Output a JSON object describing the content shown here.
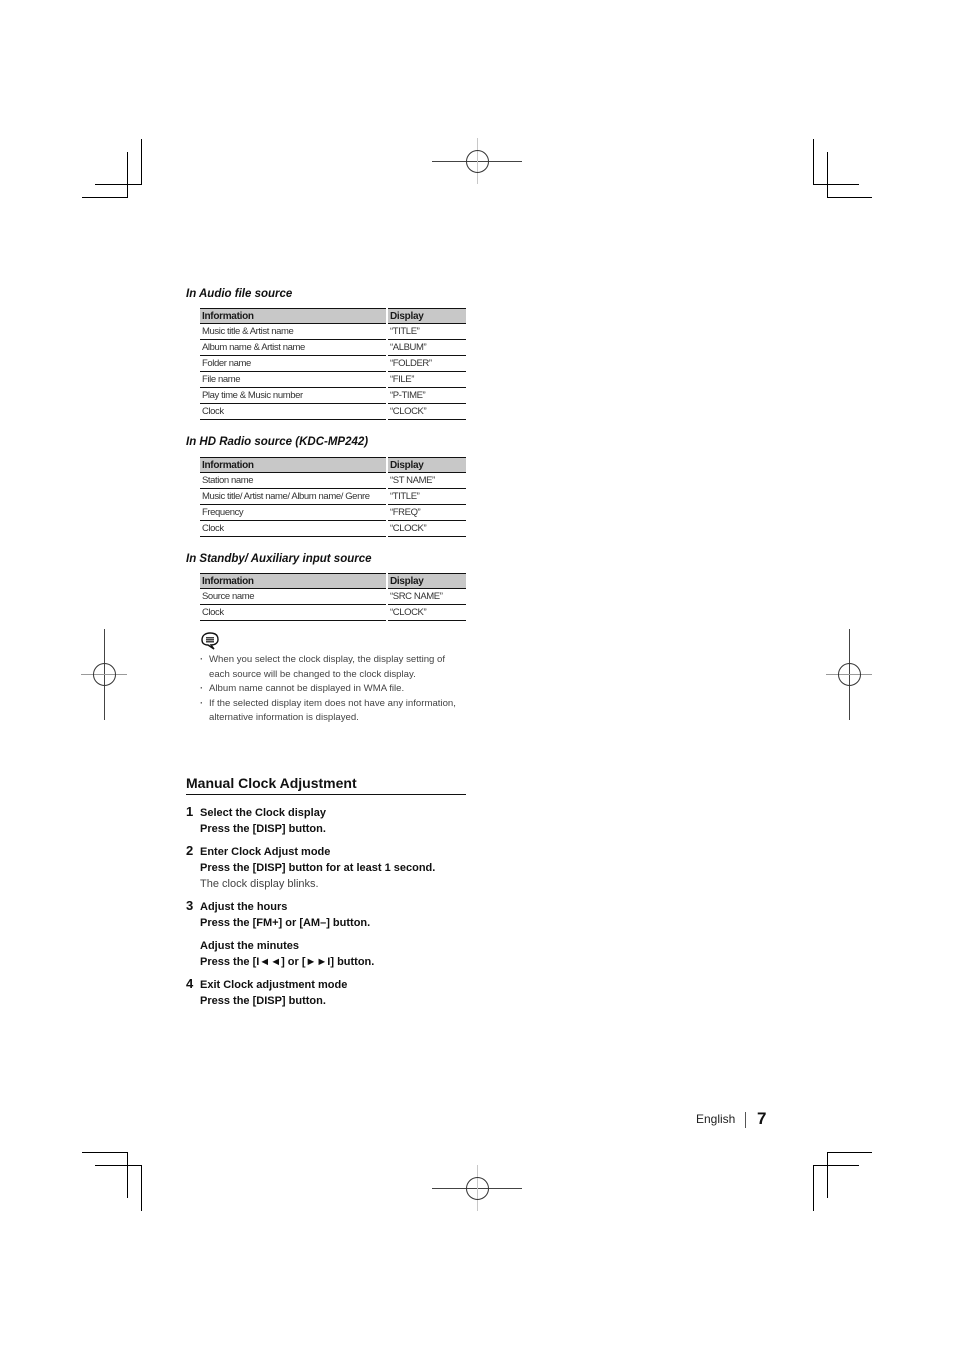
{
  "sections": [
    {
      "title": "In Audio file source",
      "columns": [
        "Information",
        "Display"
      ],
      "rows": [
        [
          "Music title & Artist name",
          "“TITLE”"
        ],
        [
          "Album name & Artist name",
          "“ALBUM”"
        ],
        [
          "Folder name",
          "“FOLDER”"
        ],
        [
          "File name",
          "“FILE”"
        ],
        [
          "Play time & Music number",
          "“P-TIME”"
        ],
        [
          "Clock",
          "“CLOCK”"
        ]
      ]
    },
    {
      "title": "In HD Radio source (KDC-MP242)",
      "columns": [
        "Information",
        "Display"
      ],
      "rows": [
        [
          "Station name",
          "“ST NAME”"
        ],
        [
          "Music title/ Artist name/ Album name/ Genre",
          "“TITLE”"
        ],
        [
          "Frequency",
          "“FREQ”"
        ],
        [
          "Clock",
          "“CLOCK”"
        ]
      ]
    },
    {
      "title": "In Standby/ Auxiliary input source",
      "columns": [
        "Information",
        "Display"
      ],
      "rows": [
        [
          "Source name",
          "“SRC NAME”"
        ],
        [
          "Clock",
          "“CLOCK”"
        ]
      ]
    }
  ],
  "notes": {
    "icon": "note-speech-bubble-icon",
    "items": [
      "When you select the clock display, the display setting of each source will be changed to the clock display.",
      "Album name cannot be displayed in WMA file.",
      "If the selected display item does not have any information, alternative information is displayed."
    ]
  },
  "clock_adjustment": {
    "title": "Manual Clock Adjustment",
    "steps": [
      {
        "number": "1",
        "heading": "Select the Clock display",
        "action": "Press the [DISP] button.",
        "result": ""
      },
      {
        "number": "2",
        "heading": "Enter Clock Adjust mode",
        "action": "Press the [DISP] button for at least 1 second.",
        "result": "The clock display blinks."
      },
      {
        "number": "3",
        "heading": "Adjust the hours",
        "action": "Press the [FM+] or [AM–] button.",
        "sub_heading": "Adjust the minutes",
        "sub_action": "Press the [I◄◄] or [►►I] button."
      },
      {
        "number": "4",
        "heading": "Exit Clock adjustment mode",
        "action": "Press the [DISP] button.",
        "result": ""
      }
    ]
  },
  "footer": {
    "language": "English",
    "page_number": "7"
  }
}
